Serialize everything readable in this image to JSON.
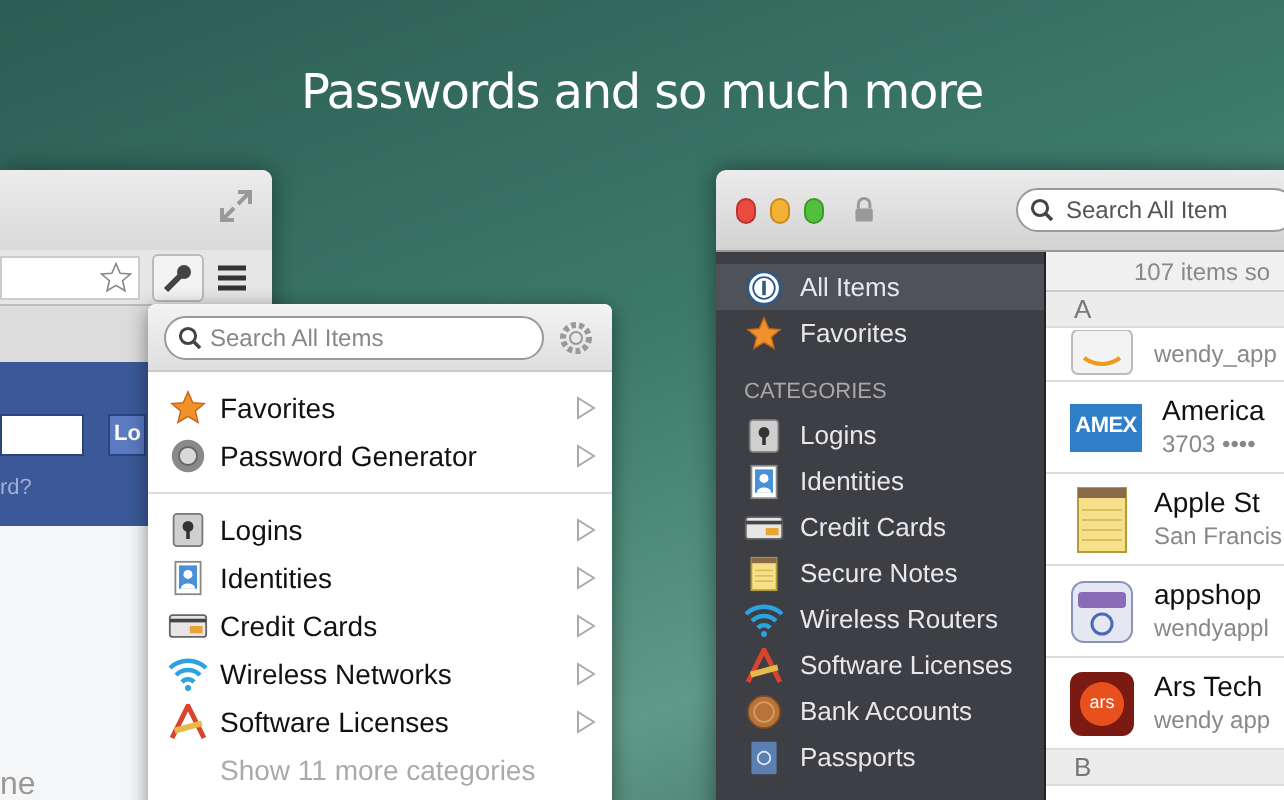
{
  "headline": "Passwords and so much more",
  "browser": {
    "login_button": "Lo",
    "link": "rd?",
    "footer_text": "ne"
  },
  "popup": {
    "search": {
      "placeholder": "Search All Items"
    },
    "sections": [
      [
        {
          "label": "Favorites",
          "kind": "star"
        },
        {
          "label": "Password Generator",
          "kind": "dial"
        }
      ],
      [
        {
          "label": "Logins",
          "kind": "login"
        },
        {
          "label": "Identities",
          "kind": "identity"
        },
        {
          "label": "Credit Cards",
          "kind": "card"
        },
        {
          "label": "Wireless Networks",
          "kind": "wifi"
        },
        {
          "label": "Software Licenses",
          "kind": "license"
        }
      ]
    ],
    "more": "Show 11 more categories"
  },
  "app": {
    "search": {
      "placeholder": "Search All Item"
    },
    "sidebar": {
      "items": [
        {
          "label": "All Items",
          "kind": "info",
          "selected": true
        },
        {
          "label": "Favorites",
          "kind": "star",
          "selected": false
        }
      ],
      "section_title": "CATEGORIES",
      "categories": [
        {
          "label": "Logins",
          "kind": "login",
          "selected": false
        },
        {
          "label": "Identities",
          "kind": "identity",
          "selected": false
        },
        {
          "label": "Credit Cards",
          "kind": "card",
          "selected": false
        },
        {
          "label": "Secure Notes",
          "kind": "note",
          "selected": false
        },
        {
          "label": "Wireless Routers",
          "kind": "wifi",
          "selected": false
        },
        {
          "label": "Software Licenses",
          "kind": "license",
          "selected": false
        },
        {
          "label": "Bank Accounts",
          "kind": "bank",
          "selected": false
        },
        {
          "label": "Passports",
          "kind": "passport",
          "selected": false
        }
      ]
    },
    "list": {
      "count": "107 items so",
      "groups": [
        {
          "letter": "A",
          "items": [
            {
              "subtitle": "wendy_app",
              "kind": "amazon"
            },
            {
              "title": "America",
              "subtitle": "3703 ••••",
              "kind": "amex",
              "logo_text": "AMEX"
            },
            {
              "title": "Apple St",
              "subtitle": "San Francis",
              "kind": "note"
            },
            {
              "title": "appshop",
              "subtitle": "wendyappl",
              "kind": "appshop"
            },
            {
              "title": "Ars Tech",
              "subtitle": "wendy app",
              "kind": "ars",
              "logo_text": "ars"
            }
          ]
        },
        {
          "letter": "B"
        }
      ]
    }
  }
}
